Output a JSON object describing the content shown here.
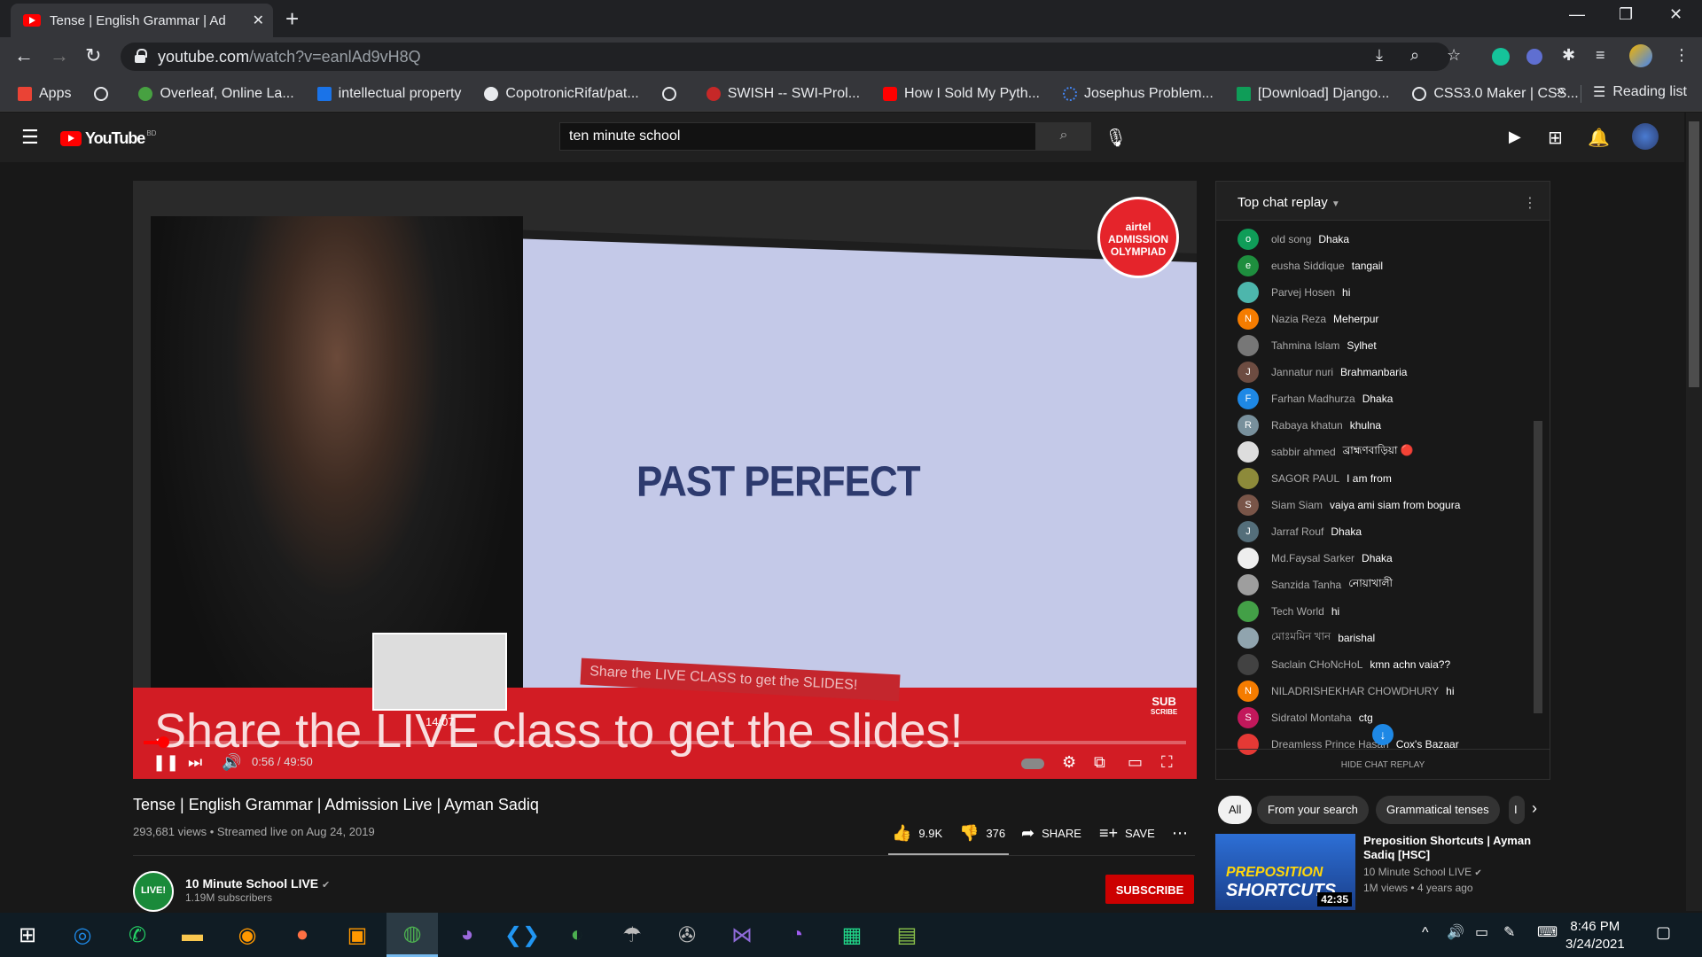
{
  "browser": {
    "tab_title": "Tense | English Grammar | Ad",
    "new_tab": "+",
    "url_host": "youtube.com",
    "url_path": "/watch?v=eanlAd9vH8Q",
    "bookmarks": [
      {
        "label": "Apps",
        "color": "#ea4335"
      },
      {
        "label": "",
        "color": "#e8eaed"
      },
      {
        "label": "Overleaf, Online La...",
        "color": "#47a141"
      },
      {
        "label": "intellectual property",
        "color": "#1a73e8"
      },
      {
        "label": "CopotronicRifat/pat...",
        "color": "#e8eaed"
      },
      {
        "label": "",
        "color": "#e8eaed"
      },
      {
        "label": "SWISH -- SWI-Prol...",
        "color": "#c62828"
      },
      {
        "label": "How I Sold My Pyth...",
        "color": "#ff0000"
      },
      {
        "label": "Josephus Problem...",
        "color": "#4285f4"
      },
      {
        "label": "[Download] Django...",
        "color": "#0f9d58"
      },
      {
        "label": "CSS3.0 Maker | CSS...",
        "color": "#e8eaed"
      }
    ],
    "bookmarks_more": "»",
    "reading_list": "Reading list"
  },
  "youtube": {
    "logo": "YouTube",
    "country": "BD",
    "search_value": "ten minute school"
  },
  "player": {
    "slide_text": "PAST PERFECT",
    "olympiad_line1": "airtel",
    "olympiad_line2": "ADMISSION",
    "olympiad_line3": "OLYMPIAD",
    "banner_text": "Share the LIVE class to get the slides!",
    "banner_small": "Share the LIVE CLASS to get the SLIDES!",
    "preview_time": "14:07",
    "time": "0:56 / 49:50",
    "progress_fraction": 0.019,
    "watermark_line1": "SUB",
    "watermark_line2": "SCRIBE"
  },
  "chat": {
    "header": "Top chat replay",
    "hide": "HIDE CHAT REPLAY",
    "messages": [
      {
        "author": "old song",
        "text": "Dhaka",
        "initial": "o",
        "color": "#0f9d58"
      },
      {
        "author": "eusha Siddique",
        "text": "tangail",
        "initial": "e",
        "color": "#1e8e3e"
      },
      {
        "author": "Parvej Hosen",
        "text": "hi",
        "initial": "",
        "color": "#4db6ac"
      },
      {
        "author": "Nazia Reza",
        "text": "Meherpur",
        "initial": "N",
        "color": "#f57c00"
      },
      {
        "author": "Tahmina Islam",
        "text": "Sylhet",
        "initial": "",
        "color": "#777777"
      },
      {
        "author": "Jannatur nuri",
        "text": "Brahmanbaria",
        "initial": "J",
        "color": "#6d4c41"
      },
      {
        "author": "Farhan Madhurza",
        "text": "Dhaka",
        "initial": "F",
        "color": "#1e88e5"
      },
      {
        "author": "Rabaya khatun",
        "text": "khulna",
        "initial": "R",
        "color": "#78909c"
      },
      {
        "author": "sabbir ahmed",
        "text": "ব্রাহ্মণবাড়িয়া 🔴",
        "initial": "",
        "color": "#dddddd"
      },
      {
        "author": "SAGOR PAUL",
        "text": "I am from",
        "initial": "",
        "color": "#8d8a3a"
      },
      {
        "author": "Siam Siam",
        "text": "vaiya ami siam from bogura",
        "initial": "S",
        "color": "#795548"
      },
      {
        "author": "Jarraf Rouf",
        "text": "Dhaka",
        "initial": "J",
        "color": "#546e7a"
      },
      {
        "author": "Md.Faysal Sarker",
        "text": "Dhaka",
        "initial": "",
        "color": "#eeeeee"
      },
      {
        "author": "Sanzida Tanha",
        "text": "নোয়াখালী",
        "initial": "",
        "color": "#9e9e9e"
      },
      {
        "author": "Tech World",
        "text": "hi",
        "initial": "",
        "color": "#43a047"
      },
      {
        "author": "মোঃমমিন খান",
        "text": "barishal",
        "initial": "",
        "color": "#90a4ae"
      },
      {
        "author": "Saclain CHoNcHoL",
        "text": "kmn achn vaia??",
        "initial": "",
        "color": "#424242"
      },
      {
        "author": "NILADRISHEKHAR CHOWDHURY",
        "text": "hi",
        "initial": "N",
        "color": "#f57c00"
      },
      {
        "author": "Sidratol Montaha",
        "text": "ctg",
        "initial": "S",
        "color": "#c2185b"
      },
      {
        "author": "Dreamless Prince Hasan",
        "text": "Cox's Bazaar",
        "initial": "",
        "color": "#e53935"
      }
    ]
  },
  "video": {
    "title": "Tense | English Grammar | Admission Live | Ayman Sadiq",
    "meta": "293,681 views • Streamed live on Aug 24, 2019",
    "likes": "9.9K",
    "dislikes": "376",
    "share": "SHARE",
    "save": "SAVE",
    "channel": "10 Minute School LIVE",
    "channel_avatar_text": "LIVE!",
    "subscribers": "1.19M subscribers",
    "subscribe": "SUBSCRIBE"
  },
  "chips": [
    "All",
    "From your search",
    "Grammatical tenses",
    "I"
  ],
  "recommendation": {
    "title": "Preposition Shortcuts | Ayman Sadiq [HSC]",
    "channel": "10 Minute School LIVE",
    "meta": "1M views • 4 years ago",
    "thumb_text1": "PREPOSITION",
    "thumb_text2": "SHORTCUTS",
    "duration": "42:35"
  },
  "taskbar": {
    "time": "8:46 PM",
    "date": "3/24/2021"
  }
}
